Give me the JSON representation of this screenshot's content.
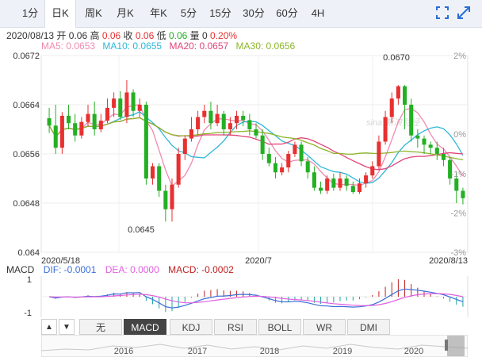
{
  "toolbar": {
    "tabs": [
      {
        "label": "1分",
        "active": false
      },
      {
        "label": "日K",
        "active": true
      },
      {
        "label": "周K",
        "active": false
      },
      {
        "label": "月K",
        "active": false
      },
      {
        "label": "年K",
        "active": false
      },
      {
        "label": "5分",
        "active": false
      },
      {
        "label": "15分",
        "active": false
      },
      {
        "label": "30分",
        "active": false
      },
      {
        "label": "60分",
        "active": false
      },
      {
        "label": "4H",
        "active": false
      }
    ],
    "icons": [
      "fullscreen-icon",
      "expand-icon"
    ]
  },
  "info": {
    "date": "2020/08/13",
    "open_label": "开",
    "open": "0.06",
    "high_label": "高",
    "high": "0.06",
    "close_label": "收",
    "close": "0.06",
    "low_label": "低",
    "low": "0.06",
    "vol_label": "量",
    "vol": "0",
    "change": "0.20%"
  },
  "ma": [
    {
      "label": "MA5: 0.0653",
      "color": "#f08ab0"
    },
    {
      "label": "MA10: 0.0655",
      "color": "#2eb7d8"
    },
    {
      "label": "MA20: 0.0657",
      "color": "#e0457a"
    },
    {
      "label": "MA30: 0.0656",
      "color": "#8db52b"
    }
  ],
  "colors": {
    "up": "#e83030",
    "down": "#23b023"
  },
  "price_axis": {
    "labels": [
      "0.0672",
      "0.0664",
      "0.0656",
      "0.0648",
      "0.064"
    ],
    "values": [
      0.0672,
      0.0664,
      0.0656,
      0.0648,
      0.064
    ]
  },
  "pct_axis": {
    "labels": [
      "2%",
      "0%",
      "-1%",
      "-2%",
      "-3%"
    ],
    "values": [
      2,
      0,
      -1,
      -2,
      -3
    ]
  },
  "annotations": {
    "high": "0.0670",
    "low": "0.0645"
  },
  "watermark": "sina 新浪财经",
  "date_axis": [
    "2020/5/18",
    "2020/7",
    "2020/8/13"
  ],
  "macd": {
    "name": "MACD",
    "dif": "DIF: -0.0001",
    "dea": "DEA: 0.0000",
    "macd": "MACD: -0.0002",
    "dif_color": "#3b6fd8",
    "dea_color": "#e060e0",
    "macd_color": "#c02020",
    "axis_labels": [
      "1",
      "-1"
    ]
  },
  "indicators": [
    {
      "label": "无",
      "active": false
    },
    {
      "label": "MACD",
      "active": true
    },
    {
      "label": "KDJ",
      "active": false
    },
    {
      "label": "RSI",
      "active": false
    },
    {
      "label": "BOLL",
      "active": false
    },
    {
      "label": "WR",
      "active": false
    },
    {
      "label": "DMI",
      "active": false
    }
  ],
  "arrows": [
    "▲",
    "▼"
  ],
  "navigator_years": [
    "2016",
    "2017",
    "2018",
    "2019",
    "2020"
  ],
  "chart_data": {
    "type": "candlestick",
    "candles": [
      [
        0.06618,
        0.06606,
        0.06635,
        0.06594
      ],
      [
        0.06606,
        0.0657,
        0.0664,
        0.0656
      ],
      [
        0.0657,
        0.06622,
        0.06628,
        0.0656
      ],
      [
        0.06622,
        0.0661,
        0.0664,
        0.066
      ],
      [
        0.0661,
        0.0659,
        0.06625,
        0.0658
      ],
      [
        0.0659,
        0.06612,
        0.0662,
        0.06585
      ],
      [
        0.06612,
        0.06625,
        0.0664,
        0.06605
      ],
      [
        0.06625,
        0.066,
        0.06645,
        0.0659
      ],
      [
        0.066,
        0.06614,
        0.06625,
        0.06595
      ],
      [
        0.06614,
        0.06635,
        0.0665,
        0.0661
      ],
      [
        0.06635,
        0.0665,
        0.0666,
        0.0662
      ],
      [
        0.0665,
        0.0662,
        0.06662,
        0.06615
      ],
      [
        0.0662,
        0.0666,
        0.0668,
        0.0661
      ],
      [
        0.0666,
        0.0663,
        0.06665,
        0.0662
      ],
      [
        0.0663,
        0.0664,
        0.0665,
        0.0662
      ],
      [
        0.0664,
        0.0652,
        0.06645,
        0.0651
      ],
      [
        0.0652,
        0.0654,
        0.06545,
        0.0651
      ],
      [
        0.0654,
        0.065,
        0.06545,
        0.0649
      ],
      [
        0.065,
        0.0647,
        0.0651,
        0.0645
      ],
      [
        0.0647,
        0.0651,
        0.0652,
        0.0645
      ],
      [
        0.0651,
        0.0656,
        0.0657,
        0.06505
      ],
      [
        0.0656,
        0.06585,
        0.0659,
        0.0655
      ],
      [
        0.06585,
        0.066,
        0.0662,
        0.0658
      ],
      [
        0.066,
        0.0662,
        0.0663,
        0.0659
      ],
      [
        0.0662,
        0.0663,
        0.0664,
        0.0661
      ],
      [
        0.0663,
        0.0661,
        0.06645,
        0.066
      ],
      [
        0.0661,
        0.06625,
        0.0664,
        0.06605
      ],
      [
        0.06625,
        0.066,
        0.0663,
        0.0659
      ],
      [
        0.066,
        0.0661,
        0.0662,
        0.0659
      ],
      [
        0.0661,
        0.06622,
        0.0663,
        0.066
      ],
      [
        0.06622,
        0.06615,
        0.0663,
        0.06605
      ],
      [
        0.06615,
        0.066,
        0.06625,
        0.0659
      ],
      [
        0.066,
        0.0659,
        0.0661,
        0.06585
      ],
      [
        0.0659,
        0.0656,
        0.066,
        0.0655
      ],
      [
        0.0656,
        0.06545,
        0.0657,
        0.0654
      ],
      [
        0.06545,
        0.0653,
        0.06555,
        0.0652
      ],
      [
        0.0653,
        0.06538,
        0.06545,
        0.06525
      ],
      [
        0.06538,
        0.0656,
        0.06565,
        0.0653
      ],
      [
        0.0656,
        0.06575,
        0.0658,
        0.06555
      ],
      [
        0.06575,
        0.06548,
        0.0658,
        0.0654
      ],
      [
        0.06548,
        0.0653,
        0.06555,
        0.0652
      ],
      [
        0.0653,
        0.06505,
        0.0654,
        0.065
      ],
      [
        0.06505,
        0.065,
        0.06515,
        0.06495
      ],
      [
        0.065,
        0.0652,
        0.06525,
        0.06495
      ],
      [
        0.0652,
        0.06505,
        0.06528,
        0.065
      ],
      [
        0.06505,
        0.0652,
        0.0653,
        0.065
      ],
      [
        0.0652,
        0.06508,
        0.06525,
        0.065
      ],
      [
        0.06508,
        0.06498,
        0.06515,
        0.06495
      ],
      [
        0.06498,
        0.06512,
        0.0652,
        0.06495
      ],
      [
        0.06512,
        0.06525,
        0.0653,
        0.06505
      ],
      [
        0.06525,
        0.0654,
        0.06548,
        0.0652
      ],
      [
        0.0654,
        0.0658,
        0.0659,
        0.06535
      ],
      [
        0.0658,
        0.0662,
        0.0663,
        0.06575
      ],
      [
        0.0662,
        0.0665,
        0.0666,
        0.0661
      ],
      [
        0.0665,
        0.0667,
        0.06672,
        0.0664
      ],
      [
        0.0667,
        0.0664,
        0.06672,
        0.066
      ],
      [
        0.0664,
        0.0659,
        0.0665,
        0.0658
      ],
      [
        0.0659,
        0.06585,
        0.066,
        0.0657
      ],
      [
        0.06585,
        0.06575,
        0.0659,
        0.0656
      ],
      [
        0.06575,
        0.0657,
        0.0658,
        0.0656
      ],
      [
        0.0657,
        0.0656,
        0.0658,
        0.0655
      ],
      [
        0.0656,
        0.0655,
        0.0657,
        0.0654
      ],
      [
        0.0655,
        0.0652,
        0.06555,
        0.0651
      ],
      [
        0.0652,
        0.065,
        0.0653,
        0.0648
      ],
      [
        0.065,
        0.06488,
        0.06505,
        0.06478
      ]
    ]
  }
}
